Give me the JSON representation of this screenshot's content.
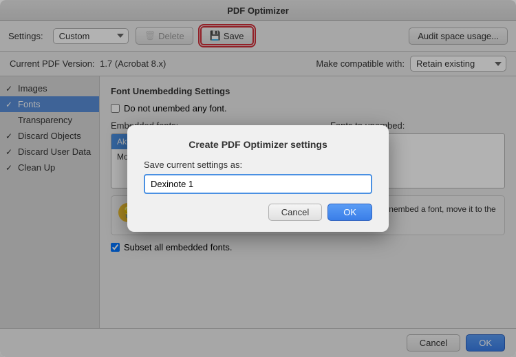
{
  "window": {
    "title": "PDF Optimizer"
  },
  "toolbar": {
    "settings_label": "Settings:",
    "settings_value": "Custom",
    "delete_label": "Delete",
    "save_label": "Save",
    "audit_label": "Audit space usage..."
  },
  "compat": {
    "version_label": "Current PDF Version:",
    "version_value": "1.7 (Acrobat 8.x)",
    "make_label": "Make compatible with:",
    "make_value": "Retain existing"
  },
  "sidebar": {
    "items": [
      {
        "label": "Images",
        "checked": true
      },
      {
        "label": "Fonts",
        "checked": true,
        "active": true
      },
      {
        "label": "Transparency",
        "checked": false
      },
      {
        "label": "Discard Objects",
        "checked": true
      },
      {
        "label": "Discard User Data",
        "checked": true
      },
      {
        "label": "Clean Up",
        "checked": true
      }
    ]
  },
  "content": {
    "section_title": "Font Unembedding Settings",
    "no_unembed_label": "Do not unembed any font.",
    "embedded_fonts_label": "Embedded fonts:",
    "embedded_fonts": [
      "AktivGrotesk-XBold (Subset)",
      "Montserrat-Black (Subset)"
    ],
    "fonts_to_unembed_label": "Fonts to unembed:",
    "fonts_to_unembed": [],
    "move_right_label": "►",
    "move_left_label": "◄",
    "info_text": "The fonts listed above are currently embedded in the PDF file. To unembed a font, move it to the right pane. Fonts listed in the left pane will remain embedded.",
    "subset_label": "Subset all embedded fonts."
  },
  "dialog": {
    "title": "Create PDF Optimizer settings",
    "prompt_label": "Save current settings as:",
    "input_value": "Dexinote 1",
    "cancel_label": "Cancel",
    "ok_label": "OK"
  },
  "bottom_bar": {
    "cancel_label": "Cancel",
    "ok_label": "OK"
  }
}
